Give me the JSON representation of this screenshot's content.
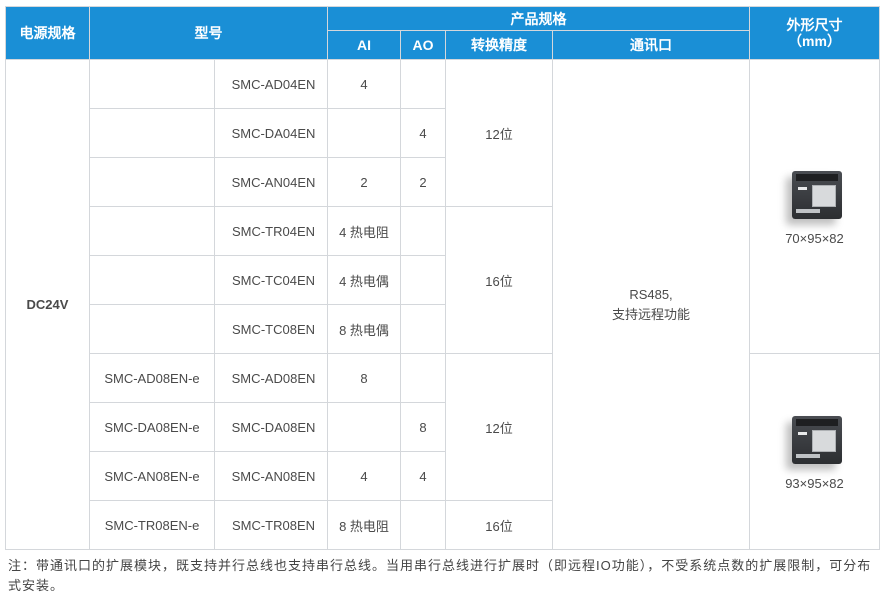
{
  "headers": {
    "power": "电源规格",
    "model": "型号",
    "spec": "产品规格",
    "ai": "AI",
    "ao": "AO",
    "precision": "转换精度",
    "comm": "通讯口",
    "dimension_line1": "外形尺寸",
    "dimension_line2": "（mm）"
  },
  "power_value": "DC24V",
  "comm_value_line1": "RS485,",
  "comm_value_line2": "支持远程功能",
  "rows": [
    {
      "model_ext": "",
      "model": "SMC-AD04EN",
      "ai": "4",
      "ao": ""
    },
    {
      "model_ext": "",
      "model": "SMC-DA04EN",
      "ai": "",
      "ao": "4"
    },
    {
      "model_ext": "",
      "model": "SMC-AN04EN",
      "ai": "2",
      "ao": "2"
    },
    {
      "model_ext": "",
      "model": "SMC-TR04EN",
      "ai": "4 热电阻",
      "ao": ""
    },
    {
      "model_ext": "",
      "model": "SMC-TC04EN",
      "ai": "4 热电偶",
      "ao": ""
    },
    {
      "model_ext": "",
      "model": "SMC-TC08EN",
      "ai": "8 热电偶",
      "ao": ""
    },
    {
      "model_ext": "SMC-AD08EN-e",
      "model": "SMC-AD08EN",
      "ai": "8",
      "ao": ""
    },
    {
      "model_ext": "SMC-DA08EN-e",
      "model": "SMC-DA08EN",
      "ai": "",
      "ao": "8"
    },
    {
      "model_ext": "SMC-AN08EN-e",
      "model": "SMC-AN08EN",
      "ai": "4",
      "ao": "4"
    },
    {
      "model_ext": "SMC-TR08EN-e",
      "model": "SMC-TR08EN",
      "ai": "8 热电阻",
      "ao": ""
    }
  ],
  "precision_groups": [
    "12位",
    "16位",
    "12位",
    "16位"
  ],
  "dimensions": [
    "70×95×82",
    "93×95×82"
  ],
  "note": "注：带通讯口的扩展模块，既支持并行总线也支持串行总线。当用串行总线进行扩展时（即远程IO功能），不受系统点数的扩展限制，可分布式安装。"
}
